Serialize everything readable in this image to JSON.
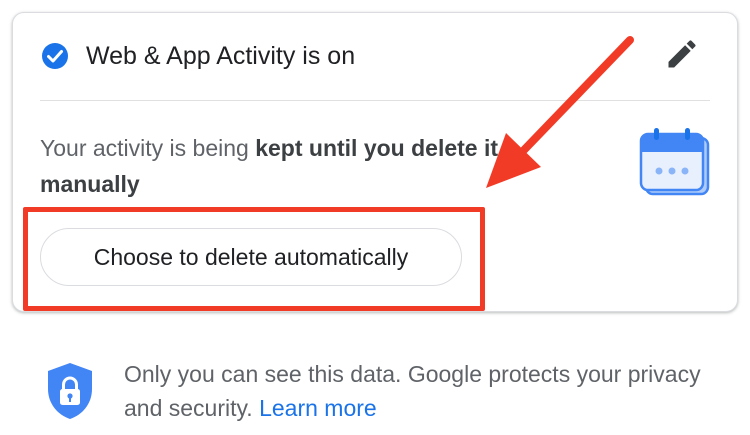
{
  "activity_card": {
    "title": "Web & App Activity is on",
    "description_prefix": "Your activity is being ",
    "description_bold": "kept until you delete it manually",
    "auto_delete_button_label": "Choose to delete automatically",
    "icons": {
      "status": "check-circle-icon",
      "edit": "pencil-icon",
      "illustration": "calendar-icon"
    }
  },
  "annotation": {
    "highlight_color": "#f23b27",
    "arrow_color": "#f23b27"
  },
  "privacy_notice": {
    "text": "Only you can see this data. Google protects your privacy and security.",
    "link_label": "Learn more",
    "icon": "shield-lock-icon"
  },
  "colors": {
    "accent": "#1a73e8",
    "shield": "#4285f4",
    "text_primary": "#202124",
    "text_secondary": "#5f6368"
  }
}
